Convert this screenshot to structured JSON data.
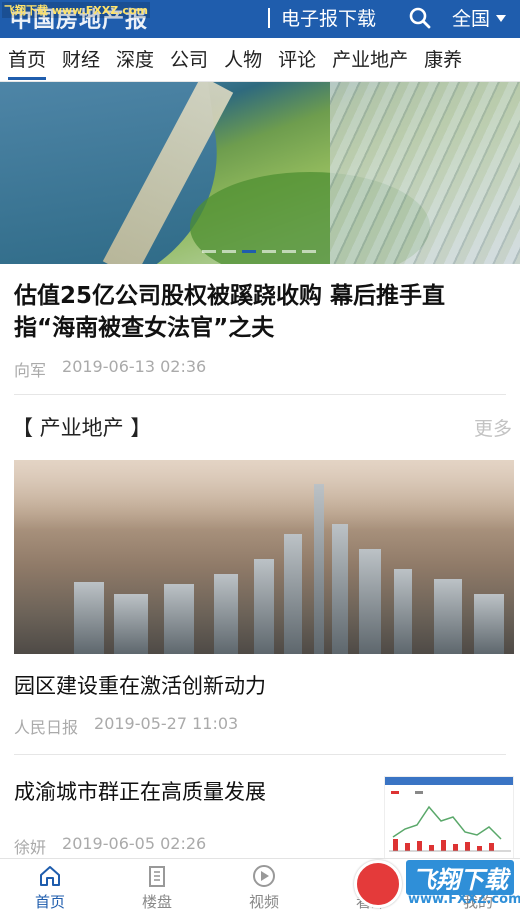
{
  "header": {
    "logo_text": "中国房地产报",
    "watermark": "飞翔下载 www.FXXZ.com",
    "epaper_label": "电子报下载",
    "region_label": "全国"
  },
  "tabs": [
    "首页",
    "财经",
    "深度",
    "公司",
    "人物",
    "评论",
    "产业地产",
    "康养"
  ],
  "active_tab": 0,
  "hero": {
    "slide_count": 6,
    "active_slide": 3
  },
  "top_article": {
    "title": "估值25亿公司股权被蹊跷收购 幕后推手直指“海南被查女法官”之夫",
    "author": "向军",
    "time": "2019-06-13 02:36"
  },
  "section": {
    "title": "【 产业地产 】",
    "more": "更多"
  },
  "articles": [
    {
      "title": "园区建设重在激活创新动力",
      "source": "人民日报",
      "time": "2019-05-27 11:03"
    },
    {
      "title": "成渝城市群正在高质量发展",
      "source": "徐妍",
      "time": "2019-06-05 02:26"
    }
  ],
  "bottom_nav": [
    {
      "label": "首页",
      "icon": "home-icon"
    },
    {
      "label": "楼盘",
      "icon": "building-icon"
    },
    {
      "label": "视频",
      "icon": "play-icon"
    },
    {
      "label": "看洋",
      "icon": "globe-icon"
    },
    {
      "label": "我的",
      "icon": "user-icon"
    }
  ],
  "badge": {
    "text": "飞翔下载",
    "url": "www.FXXZ.com"
  },
  "colors": {
    "brand": "#1f5dad",
    "meta": "#aaaaaa"
  }
}
